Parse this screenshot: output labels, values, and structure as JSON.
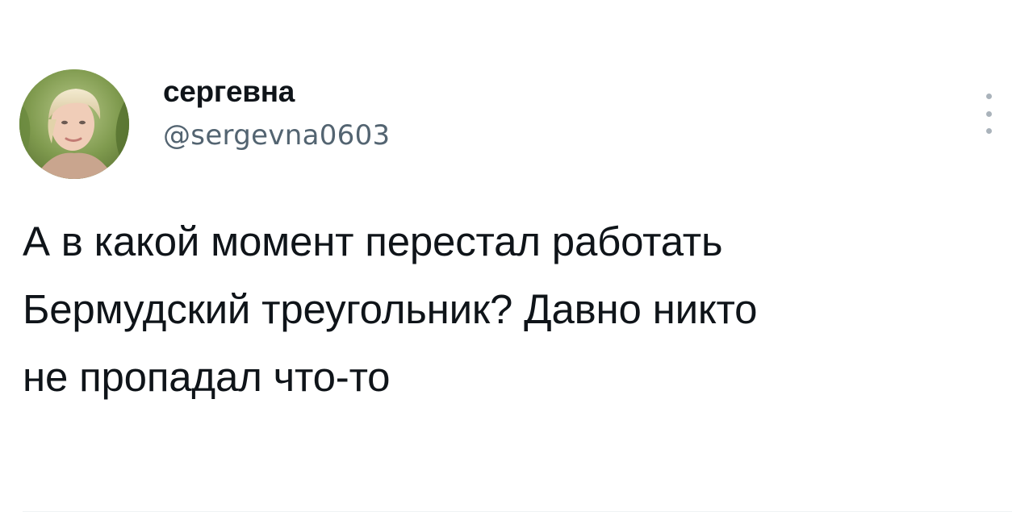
{
  "tweet": {
    "author": {
      "display_name": "сергевна",
      "handle": "@sergevna0603",
      "avatar_icon": "user-photo-avatar"
    },
    "more_icon": "vertical-ellipsis-icon",
    "text_lines": [
      "А в какой момент перестал работать",
      "Бермудский треугольник? Давно никто",
      "не пропадал что-то"
    ]
  },
  "colors": {
    "text_primary": "#0f1419",
    "text_secondary": "#536471",
    "background": "#ffffff"
  }
}
